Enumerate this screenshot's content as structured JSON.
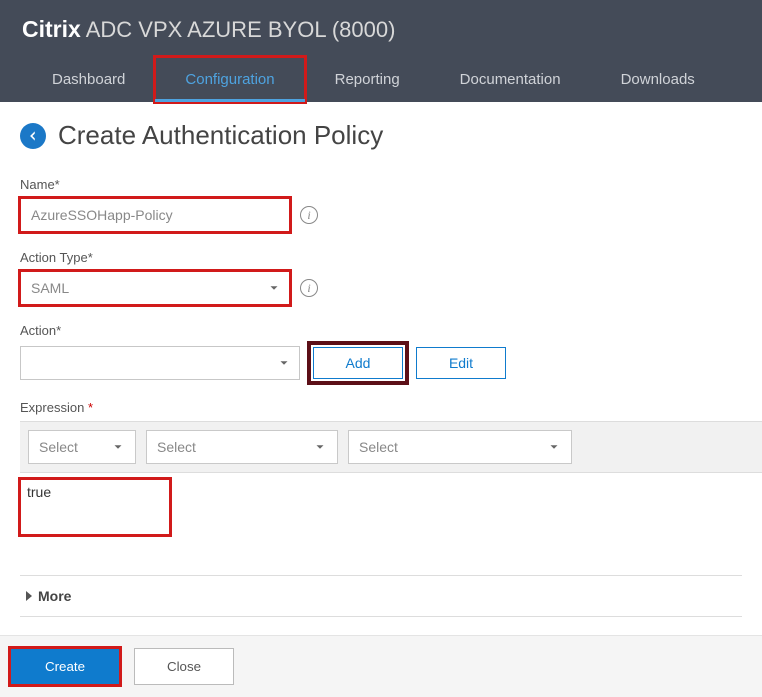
{
  "brand": {
    "logo": "Citrix",
    "product": "ADC VPX AZURE BYOL (8000)"
  },
  "nav": {
    "dashboard": "Dashboard",
    "configuration": "Configuration",
    "reporting": "Reporting",
    "documentation": "Documentation",
    "downloads": "Downloads"
  },
  "page": {
    "title": "Create Authentication Policy",
    "name_label": "Name*",
    "name_value": "AzureSSOHapp-Policy",
    "action_type_label": "Action Type*",
    "action_type_value": "SAML",
    "action_label": "Action*",
    "action_value": "",
    "add_btn": "Add",
    "edit_btn": "Edit",
    "expression_label": "Expression",
    "expr_select1": "Select",
    "expr_select2": "Select",
    "expr_select3": "Select",
    "expr_value": "true",
    "more": "More",
    "create_btn": "Create",
    "close_btn": "Close"
  }
}
